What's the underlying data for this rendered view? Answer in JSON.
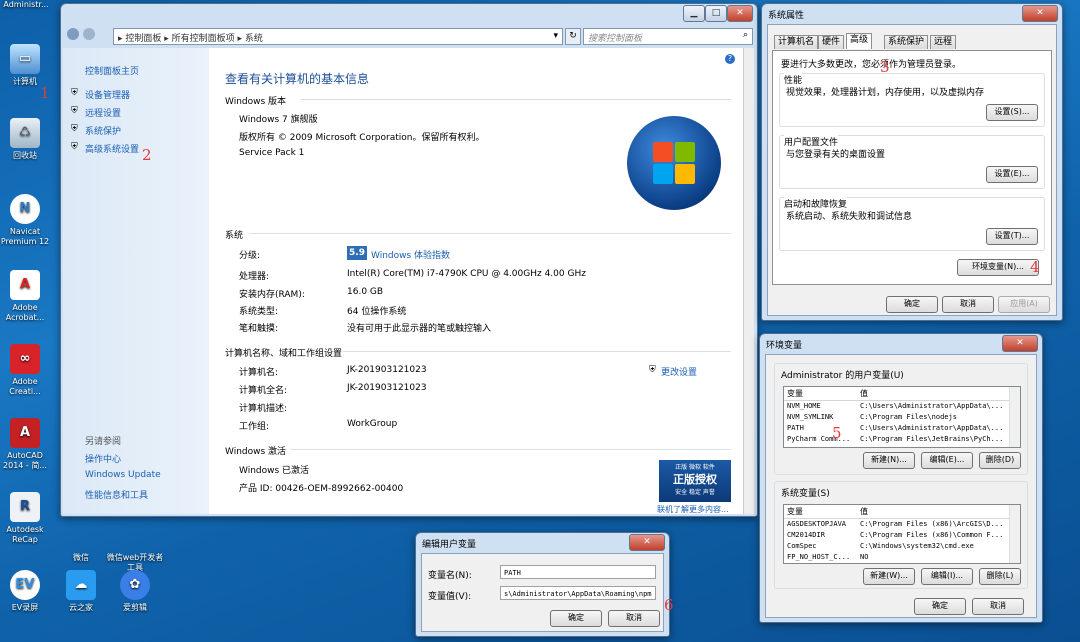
{
  "desktop": {
    "icons": [
      {
        "label": "Administr..."
      },
      {
        "label": "计算机"
      },
      {
        "label": "回收站"
      },
      {
        "label": "Navicat Premium 12"
      },
      {
        "label": "Adobe Acrobat..."
      },
      {
        "label": "Adobe Creati..."
      },
      {
        "label": "AutoCAD 2014 - 简..."
      },
      {
        "label": "Autodesk ReCap"
      },
      {
        "label": "EV录屏"
      },
      {
        "label": "微信"
      },
      {
        "label": "微信web开发者工具"
      },
      {
        "label": "云之家"
      },
      {
        "label": "爱剪辑"
      }
    ],
    "annotations": [
      "1",
      "2",
      "3",
      "4",
      "5",
      "6"
    ]
  },
  "control_panel": {
    "breadcrumb": [
      "控制面板",
      "所有控制面板项",
      "系统"
    ],
    "search_placeholder": "搜索控制面板",
    "left": {
      "home": "控制面板主页",
      "links": [
        "设备管理器",
        "远程设置",
        "系统保护",
        "高级系统设置"
      ],
      "see_also_title": "另请参阅",
      "see_also": [
        "操作中心",
        "Windows Update",
        "性能信息和工具"
      ]
    },
    "heading": "查看有关计算机的基本信息",
    "edition": {
      "title": "Windows 版本",
      "name": "Windows 7 旗舰版",
      "copyright": "版权所有 © 2009 Microsoft Corporation。保留所有权利。",
      "sp": "Service Pack 1"
    },
    "system": {
      "title": "系统",
      "rating_label": "分级:",
      "rating_value": "5.9",
      "rating_link": "Windows 体验指数",
      "rows": [
        {
          "k": "处理器:",
          "v": "Intel(R) Core(TM) i7-4790K CPU @ 4.00GHz   4.00 GHz"
        },
        {
          "k": "安装内存(RAM):",
          "v": "16.0 GB"
        },
        {
          "k": "系统类型:",
          "v": "64 位操作系统"
        },
        {
          "k": "笔和触摸:",
          "v": "没有可用于此显示器的笔或触控输入"
        }
      ]
    },
    "computer": {
      "title": "计算机名称、域和工作组设置",
      "change": "更改设置",
      "rows": [
        {
          "k": "计算机名:",
          "v": "JK-201903121023"
        },
        {
          "k": "计算机全名:",
          "v": "JK-201903121023"
        },
        {
          "k": "计算机描述:",
          "v": ""
        },
        {
          "k": "工作组:",
          "v": "WorkGroup"
        }
      ]
    },
    "activation": {
      "title": "Windows 激活",
      "status": "Windows 已激活",
      "product_id": "产品 ID: 00426-OEM-8992662-00400",
      "badge_top": "正版 微软 软件",
      "badge_main": "正版授权",
      "badge_sub": "安全 稳定 声誉",
      "more_link": "联机了解更多内容..."
    }
  },
  "sys_props": {
    "title": "系统属性",
    "tabs": [
      "计算机名",
      "硬件",
      "高级",
      "系统保护",
      "远程"
    ],
    "admin_note": "要进行大多数更改，您必须作为管理员登录。",
    "groups": [
      {
        "title": "性能",
        "desc": "视觉效果，处理器计划，内存使用，以及虚拟内存",
        "btn": "设置(S)..."
      },
      {
        "title": "用户配置文件",
        "desc": "与您登录有关的桌面设置",
        "btn": "设置(E)..."
      },
      {
        "title": "启动和故障恢复",
        "desc": "系统启动、系统失败和调试信息",
        "btn": "设置(T)..."
      }
    ],
    "env_btn": "环境变量(N)...",
    "ok": "确定",
    "cancel": "取消",
    "apply": "应用(A)"
  },
  "env_vars": {
    "title": "环境变量",
    "user_title": "Administrator 的用户变量(U)",
    "col_var": "变量",
    "col_val": "值",
    "user_rows": [
      {
        "k": "NVM_HOME",
        "v": "C:\\Users\\Administrator\\AppData\\..."
      },
      {
        "k": "NVM_SYMLINK",
        "v": "C:\\Program Files\\nodejs"
      },
      {
        "k": "PATH",
        "v": "C:\\Users\\Administrator\\AppData\\..."
      },
      {
        "k": "PyCharm Comm...",
        "v": "C:\\Program Files\\JetBrains\\PyCh..."
      }
    ],
    "sys_title": "系统变量(S)",
    "sys_rows": [
      {
        "k": "AGSDESKTOPJAVA",
        "v": "C:\\Program Files (x86)\\ArcGIS\\D..."
      },
      {
        "k": "CM2014DIR",
        "v": "C:\\Program Files (x86)\\Common F..."
      },
      {
        "k": "ComSpec",
        "v": "C:\\Windows\\system32\\cmd.exe"
      },
      {
        "k": "FP_NO_HOST_C...",
        "v": "NO"
      }
    ],
    "new_u": "新建(N)...",
    "edit_u": "编辑(E)...",
    "del_u": "删除(D)",
    "new_s": "新建(W)...",
    "edit_s": "编辑(I)...",
    "del_s": "删除(L)",
    "ok": "确定",
    "cancel": "取消"
  },
  "edit_var": {
    "title": "编辑用户变量",
    "name_label": "变量名(N):",
    "name_value": "PATH",
    "value_label": "变量值(V):",
    "value_value": "s\\Administrator\\AppData\\Roaming\\npm",
    "ok": "确定",
    "cancel": "取消"
  }
}
